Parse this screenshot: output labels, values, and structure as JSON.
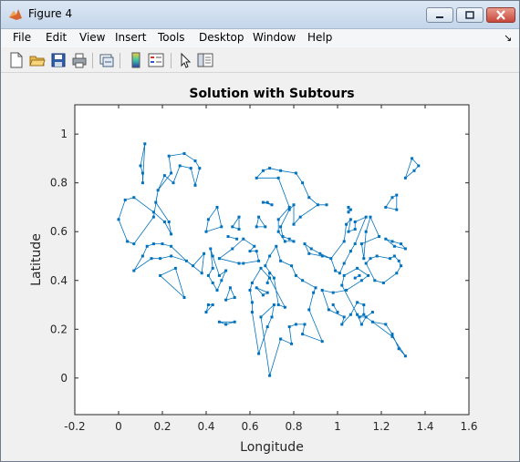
{
  "window": {
    "title": "Figure 4"
  },
  "menu": [
    "File",
    "Edit",
    "View",
    "Insert",
    "Tools",
    "Desktop",
    "Window",
    "Help"
  ],
  "toolbar_icons": [
    "new-figure-icon",
    "open-file-icon",
    "save-icon",
    "print-icon",
    "link-figure-icon",
    "insert-colorbar-icon",
    "insert-legend-icon",
    "edit-plot-icon",
    "property-inspector-icon"
  ],
  "chart_data": {
    "type": "scatter",
    "title": "Solution with Subtours",
    "xlabel": "Longitude",
    "ylabel": "Latitude",
    "xlim": [
      -0.2,
      1.6
    ],
    "ylim": [
      -0.15,
      1.12
    ],
    "xticks": [
      "-0.2",
      "0",
      "0.2",
      "0.4",
      "0.6",
      "0.8",
      "1",
      "1.2",
      "1.4",
      "1.6"
    ],
    "yticks": [
      "0",
      "0.2",
      "0.4",
      "0.6",
      "0.8",
      "1"
    ],
    "series": [
      {
        "subtours": [
          [
            [
              0.1,
              0.87
            ],
            [
              0.12,
              0.96
            ],
            [
              0.11,
              0.8
            ],
            [
              0.11,
              0.84
            ],
            [
              0.1,
              0.87
            ]
          ],
          [
            [
              0.0,
              0.65
            ],
            [
              0.03,
              0.73
            ],
            [
              0.07,
              0.74
            ],
            [
              0.16,
              0.68
            ],
            [
              0.21,
              0.64
            ],
            [
              0.24,
              0.59
            ],
            [
              0.23,
              0.64
            ],
            [
              0.17,
              0.72
            ],
            [
              0.18,
              0.77
            ],
            [
              0.24,
              0.84
            ],
            [
              0.23,
              0.91
            ],
            [
              0.3,
              0.92
            ],
            [
              0.35,
              0.89
            ],
            [
              0.37,
              0.86
            ],
            [
              0.35,
              0.79
            ],
            [
              0.33,
              0.86
            ],
            [
              0.28,
              0.87
            ],
            [
              0.25,
              0.8
            ],
            [
              0.21,
              0.83
            ],
            [
              0.18,
              0.77
            ],
            [
              0.16,
              0.66
            ],
            [
              0.07,
              0.55
            ],
            [
              0.04,
              0.56
            ],
            [
              0.0,
              0.65
            ]
          ],
          [
            [
              0.07,
              0.44
            ],
            [
              0.11,
              0.5
            ],
            [
              0.13,
              0.54
            ],
            [
              0.16,
              0.55
            ],
            [
              0.2,
              0.55
            ],
            [
              0.24,
              0.54
            ],
            [
              0.31,
              0.48
            ],
            [
              0.34,
              0.46
            ],
            [
              0.39,
              0.51
            ],
            [
              0.38,
              0.43
            ],
            [
              0.31,
              0.48
            ],
            [
              0.24,
              0.5
            ],
            [
              0.19,
              0.49
            ],
            [
              0.15,
              0.49
            ],
            [
              0.07,
              0.44
            ]
          ],
          [
            [
              0.19,
              0.42
            ],
            [
              0.3,
              0.33
            ],
            [
              0.26,
              0.45
            ],
            [
              0.19,
              0.42
            ]
          ],
          [
            [
              0.4,
              0.6
            ],
            [
              0.41,
              0.65
            ],
            [
              0.45,
              0.7
            ],
            [
              0.47,
              0.62
            ],
            [
              0.4,
              0.6
            ]
          ],
          [
            [
              0.4,
              0.27
            ],
            [
              0.41,
              0.3
            ],
            [
              0.43,
              0.3
            ],
            [
              0.4,
              0.27
            ]
          ],
          [
            [
              0.46,
              0.23
            ],
            [
              0.49,
              0.22
            ],
            [
              0.53,
              0.23
            ],
            [
              0.46,
              0.23
            ]
          ],
          [
            [
              0.42,
              0.53
            ],
            [
              0.43,
              0.45
            ],
            [
              0.41,
              0.42
            ],
            [
              0.43,
              0.39
            ],
            [
              0.45,
              0.36
            ],
            [
              0.47,
              0.4
            ],
            [
              0.49,
              0.44
            ],
            [
              0.46,
              0.42
            ],
            [
              0.43,
              0.5
            ],
            [
              0.42,
              0.53
            ]
          ],
          [
            [
              0.52,
              0.62
            ],
            [
              0.55,
              0.66
            ],
            [
              0.55,
              0.61
            ],
            [
              0.52,
              0.62
            ]
          ],
          [
            [
              0.5,
              0.58
            ],
            [
              0.54,
              0.57
            ],
            [
              0.5,
              0.58
            ]
          ],
          [
            [
              0.46,
              0.49
            ],
            [
              0.55,
              0.47
            ],
            [
              0.57,
              0.47
            ],
            [
              0.64,
              0.48
            ],
            [
              0.63,
              0.52
            ],
            [
              0.6,
              0.52
            ],
            [
              0.62,
              0.54
            ],
            [
              0.57,
              0.57
            ],
            [
              0.52,
              0.53
            ],
            [
              0.46,
              0.49
            ]
          ],
          [
            [
              0.49,
              0.32
            ],
            [
              0.51,
              0.37
            ],
            [
              0.53,
              0.33
            ],
            [
              0.49,
              0.32
            ]
          ],
          [
            [
              0.63,
              0.62
            ],
            [
              0.64,
              0.66
            ],
            [
              0.67,
              0.62
            ],
            [
              0.63,
              0.62
            ]
          ],
          [
            [
              0.66,
              0.72
            ],
            [
              0.68,
              0.72
            ],
            [
              0.7,
              0.71
            ],
            [
              0.66,
              0.72
            ]
          ],
          [
            [
              0.66,
              0.34
            ],
            [
              0.68,
              0.35
            ],
            [
              0.63,
              0.37
            ],
            [
              0.66,
              0.34
            ]
          ],
          [
            [
              0.68,
              0.39
            ],
            [
              0.69,
              0.43
            ],
            [
              0.68,
              0.39
            ]
          ],
          [
            [
              0.64,
              0.1
            ],
            [
              0.68,
              0.21
            ],
            [
              0.7,
              0.25
            ],
            [
              0.71,
              0.3
            ],
            [
              0.65,
              0.25
            ],
            [
              0.69,
              0.01
            ],
            [
              0.74,
              0.16
            ],
            [
              0.79,
              0.14
            ],
            [
              0.78,
              0.21
            ],
            [
              0.81,
              0.22
            ],
            [
              0.85,
              0.22
            ],
            [
              0.84,
              0.18
            ],
            [
              0.93,
              0.15
            ],
            [
              0.87,
              0.28
            ],
            [
              0.89,
              0.35
            ],
            [
              0.9,
              0.37
            ],
            [
              0.84,
              0.4
            ],
            [
              0.81,
              0.42
            ],
            [
              0.79,
              0.46
            ],
            [
              0.74,
              0.48
            ],
            [
              0.72,
              0.54
            ],
            [
              0.69,
              0.5
            ],
            [
              0.67,
              0.46
            ],
            [
              0.71,
              0.41
            ],
            [
              0.73,
              0.3
            ],
            [
              0.76,
              0.29
            ],
            [
              0.69,
              0.41
            ],
            [
              0.65,
              0.45
            ],
            [
              0.61,
              0.39
            ],
            [
              0.6,
              0.36
            ],
            [
              0.61,
              0.31
            ],
            [
              0.61,
              0.27
            ],
            [
              0.64,
              0.1
            ]
          ],
          [
            [
              0.63,
              0.82
            ],
            [
              0.66,
              0.85
            ],
            [
              0.69,
              0.86
            ],
            [
              0.74,
              0.85
            ],
            [
              0.81,
              0.84
            ],
            [
              0.84,
              0.8
            ],
            [
              0.87,
              0.74
            ],
            [
              0.91,
              0.71
            ],
            [
              0.95,
              0.71
            ],
            [
              0.91,
              0.71
            ],
            [
              0.83,
              0.66
            ],
            [
              0.8,
              0.63
            ],
            [
              0.8,
              0.71
            ],
            [
              0.78,
              0.69
            ],
            [
              0.74,
              0.62
            ],
            [
              0.75,
              0.58
            ],
            [
              0.78,
              0.57
            ],
            [
              0.8,
              0.56
            ],
            [
              0.76,
              0.56
            ],
            [
              0.73,
              0.6
            ],
            [
              0.73,
              0.65
            ],
            [
              0.78,
              0.7
            ],
            [
              0.73,
              0.82
            ],
            [
              0.63,
              0.82
            ]
          ],
          [
            [
              0.85,
              0.55
            ],
            [
              0.87,
              0.51
            ],
            [
              0.93,
              0.5
            ],
            [
              0.97,
              0.49
            ],
            [
              1.03,
              0.56
            ],
            [
              1.04,
              0.63
            ],
            [
              1.06,
              0.65
            ],
            [
              1.05,
              0.6
            ],
            [
              1.08,
              0.61
            ],
            [
              1.08,
              0.64
            ],
            [
              1.13,
              0.66
            ],
            [
              1.08,
              0.55
            ],
            [
              1.06,
              0.52
            ],
            [
              1.03,
              0.47
            ],
            [
              1.01,
              0.43
            ],
            [
              0.99,
              0.44
            ],
            [
              0.97,
              0.49
            ],
            [
              0.92,
              0.51
            ],
            [
              0.88,
              0.53
            ],
            [
              0.85,
              0.55
            ]
          ],
          [
            [
              1.02,
              0.38
            ],
            [
              1.03,
              0.42
            ],
            [
              1.09,
              0.45
            ],
            [
              1.14,
              0.42
            ],
            [
              1.11,
              0.4
            ],
            [
              1.04,
              0.36
            ],
            [
              0.98,
              0.35
            ],
            [
              0.93,
              0.36
            ],
            [
              0.96,
              0.28
            ],
            [
              1.03,
              0.25
            ],
            [
              1.02,
              0.22
            ],
            [
              1.06,
              0.26
            ],
            [
              1.09,
              0.31
            ],
            [
              1.12,
              0.3
            ],
            [
              1.12,
              0.26
            ],
            [
              1.1,
              0.25
            ],
            [
              1.13,
              0.25
            ],
            [
              1.11,
              0.22
            ],
            [
              1.09,
              0.26
            ],
            [
              1.02,
              0.38
            ]
          ],
          [
            [
              0.98,
              0.3
            ],
            [
              1.0,
              0.27
            ],
            [
              0.98,
              0.3
            ]
          ],
          [
            [
              1.08,
              0.41
            ],
            [
              1.1,
              0.42
            ],
            [
              1.08,
              0.41
            ]
          ],
          [
            [
              1.05,
              0.68
            ],
            [
              1.05,
              0.7
            ],
            [
              1.06,
              0.69
            ],
            [
              1.05,
              0.68
            ]
          ],
          [
            [
              1.12,
              0.49
            ],
            [
              1.13,
              0.6
            ],
            [
              1.15,
              0.66
            ],
            [
              1.19,
              0.58
            ],
            [
              1.11,
              0.55
            ],
            [
              1.12,
              0.49
            ]
          ],
          [
            [
              1.13,
              0.47
            ],
            [
              1.15,
              0.49
            ],
            [
              1.18,
              0.5
            ],
            [
              1.24,
              0.49
            ],
            [
              1.26,
              0.5
            ],
            [
              1.28,
              0.48
            ],
            [
              1.29,
              0.46
            ],
            [
              1.27,
              0.43
            ],
            [
              1.21,
              0.39
            ],
            [
              1.17,
              0.4
            ],
            [
              1.13,
              0.47
            ]
          ],
          [
            [
              1.22,
              0.57
            ],
            [
              1.25,
              0.56
            ],
            [
              1.29,
              0.55
            ],
            [
              1.31,
              0.53
            ],
            [
              1.26,
              0.54
            ],
            [
              1.22,
              0.57
            ]
          ],
          [
            [
              1.22,
              0.7
            ],
            [
              1.25,
              0.74
            ],
            [
              1.27,
              0.75
            ],
            [
              1.27,
              0.69
            ],
            [
              1.22,
              0.7
            ]
          ],
          [
            [
              1.31,
              0.82
            ],
            [
              1.34,
              0.9
            ],
            [
              1.37,
              0.87
            ],
            [
              1.35,
              0.85
            ],
            [
              1.31,
              0.82
            ]
          ],
          [
            [
              1.16,
              0.27
            ],
            [
              1.13,
              0.25
            ],
            [
              1.16,
              0.23
            ],
            [
              1.22,
              0.22
            ],
            [
              1.25,
              0.18
            ],
            [
              1.28,
              0.12
            ],
            [
              1.31,
              0.09
            ],
            [
              1.25,
              0.17
            ],
            [
              1.16,
              0.23
            ]
          ]
        ]
      }
    ],
    "grid": false,
    "marker_color": "#0072BD",
    "line_color": "#0072BD"
  }
}
